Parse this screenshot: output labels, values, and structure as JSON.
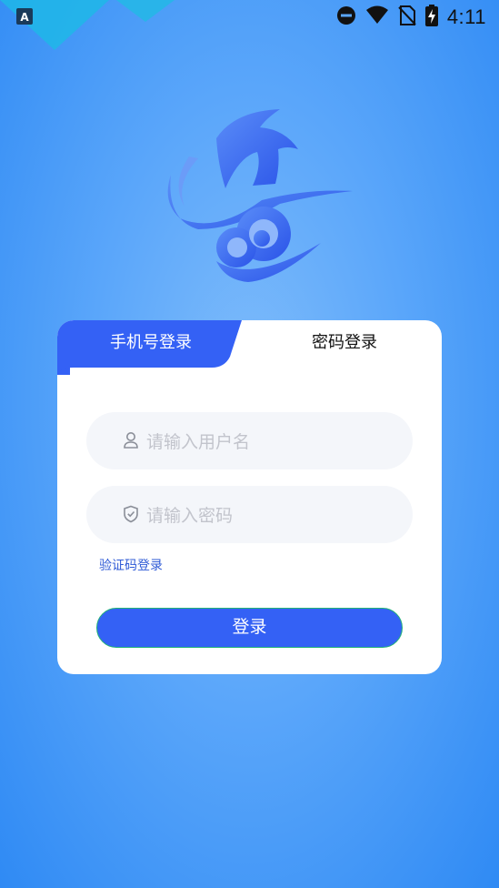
{
  "status_bar": {
    "time": "4:11",
    "icons": [
      "app-a-icon",
      "do-not-disturb-icon",
      "wifi-icon",
      "no-sim-icon",
      "battery-charging-icon"
    ],
    "notification_label": "A"
  },
  "login_card": {
    "tabs": [
      {
        "label": "手机号登录",
        "active": true
      },
      {
        "label": "密码登录",
        "active": false
      }
    ],
    "username_placeholder": "请输入用户名",
    "password_placeholder": "请输入密码",
    "sms_login_link": "验证码登录",
    "login_button": "登录"
  },
  "colors": {
    "accent": "#3461f5",
    "button_border": "#22b377",
    "background_top": "#2f8af4",
    "background_center": "#7fbcfb"
  }
}
